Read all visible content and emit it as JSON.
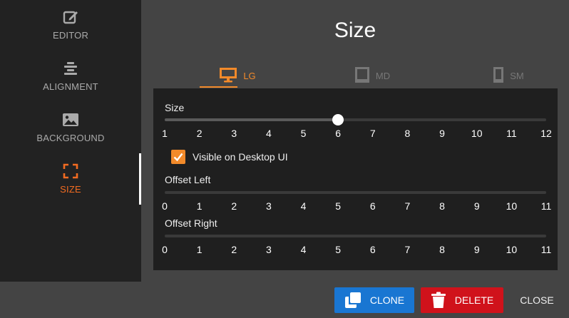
{
  "sidebar": {
    "items": [
      {
        "label": "EDITOR",
        "icon": "edit-icon"
      },
      {
        "label": "ALIGNMENT",
        "icon": "align-center-icon"
      },
      {
        "label": "BACKGROUND",
        "icon": "image-icon"
      },
      {
        "label": "SIZE",
        "icon": "expand-icon",
        "active": true
      }
    ]
  },
  "title": "Size",
  "tabs": [
    {
      "label": "LG",
      "icon": "desktop-icon",
      "active": true
    },
    {
      "label": "MD",
      "icon": "tablet-icon"
    },
    {
      "label": "SM",
      "icon": "mobile-icon"
    }
  ],
  "size_slider": {
    "label": "Size",
    "min": 1,
    "max": 12,
    "value": 6,
    "ticks": [
      "1",
      "2",
      "3",
      "4",
      "5",
      "6",
      "7",
      "8",
      "9",
      "10",
      "11",
      "12"
    ]
  },
  "visible_checkbox": {
    "label": "Visible on Desktop UI",
    "checked": true
  },
  "offset_left": {
    "label": "Offset Left",
    "min": 0,
    "max": 11,
    "value": 0,
    "ticks": [
      "0",
      "1",
      "2",
      "3",
      "4",
      "5",
      "6",
      "7",
      "8",
      "9",
      "10",
      "11"
    ]
  },
  "offset_right": {
    "label": "Offset Right",
    "min": 0,
    "max": 11,
    "value": 0,
    "ticks": [
      "0",
      "1",
      "2",
      "3",
      "4",
      "5",
      "6",
      "7",
      "8",
      "9",
      "10",
      "11"
    ]
  },
  "footer": {
    "clone_label": "CLONE",
    "delete_label": "DELETE",
    "close_label": "CLOSE"
  },
  "colors": {
    "accent": "#f28a2a",
    "clone": "#1976d2",
    "delete": "#d0121b",
    "sidebar_bg": "#222222",
    "panel_bg": "#1f1f1f"
  }
}
